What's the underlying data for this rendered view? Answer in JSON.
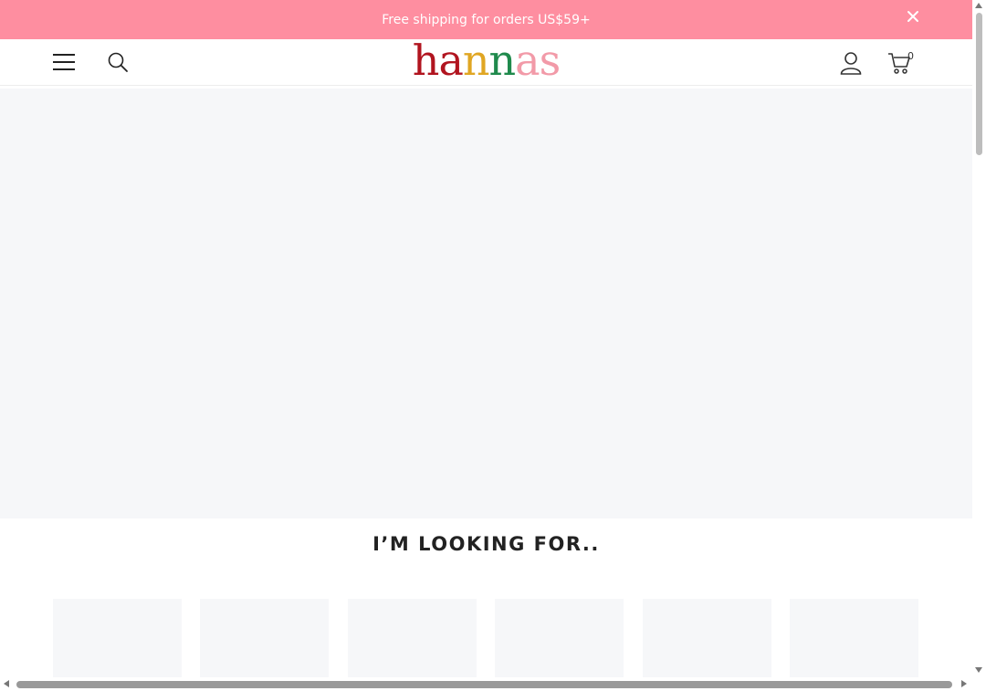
{
  "announcement": {
    "text": "Free shipping for orders US$59+",
    "background": "#fe8ea0",
    "close_icon": "close-icon"
  },
  "header": {
    "menu_icon": "hamburger-menu-icon",
    "search_icon": "search-icon",
    "logo": {
      "letters": [
        {
          "char": "h",
          "color": "#b1141f"
        },
        {
          "char": "a",
          "color": "#b1141f"
        },
        {
          "char": "n",
          "color": "#e0a623"
        },
        {
          "char": "n",
          "color": "#1f8a4c"
        },
        {
          "char": "a",
          "color": "#f29aa8"
        },
        {
          "char": "s",
          "color": "#f29aa8"
        }
      ]
    },
    "account_icon": "user-icon",
    "cart_icon": "cart-icon",
    "cart_count": "0"
  },
  "section": {
    "title": "I’M LOOKING FOR.."
  },
  "categories_count": 6
}
